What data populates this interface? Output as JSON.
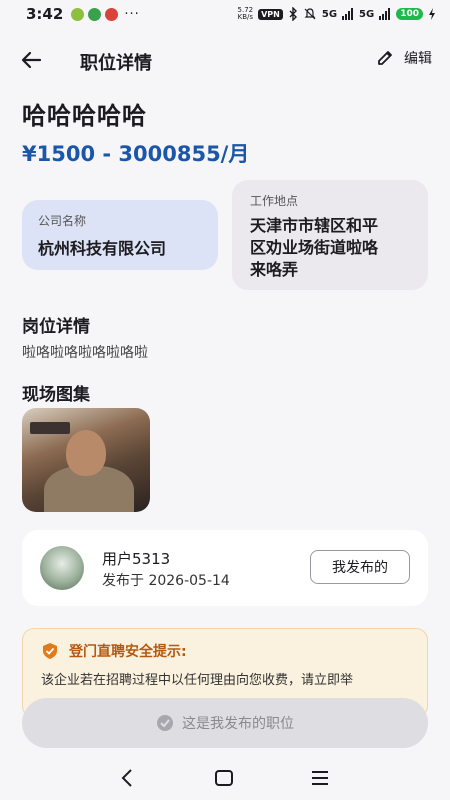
{
  "status_bar": {
    "time": "3:42",
    "dots": "···",
    "net_speed_value": "5.72",
    "net_speed_unit": "KB/s",
    "vpn": "VPN",
    "sig1": "5G",
    "sig2": "5G",
    "battery": "100"
  },
  "app_bar": {
    "title": "职位详情",
    "edit_label": "编辑"
  },
  "job": {
    "title": "哈哈哈哈哈",
    "salary": "¥1500 - 3000855/月",
    "company_label": "公司名称",
    "company": "杭州科技有限公司",
    "location_label": "工作地点",
    "location_line1": "天津市市辖区和平",
    "location_line2": "区劝业场街道啦咯",
    "location_line3": "来咯弄"
  },
  "details": {
    "title": "岗位详情",
    "description": "啦咯啦咯啦咯啦咯啦"
  },
  "gallery": {
    "title": "现场图集"
  },
  "publisher": {
    "name": "用户5313",
    "date": "发布于 2026-05-14",
    "button": "我发布的"
  },
  "warning": {
    "title": "登门直聘安全提示:",
    "text": "该企业若在招聘过程中以任何理由向您收费，请立即举"
  },
  "bottom_button": {
    "label": "这是我发布的职位"
  },
  "colors": {
    "salary": "#1a57a8",
    "company_card": "#dde3f6",
    "warning_title": "#b45a10",
    "battery": "#1fb84a"
  }
}
